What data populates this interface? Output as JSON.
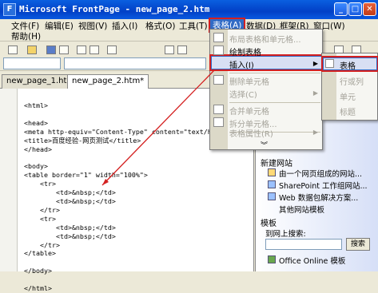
{
  "window": {
    "title": "Microsoft FrontPage - new_page_2.htm"
  },
  "menubar": {
    "items": [
      "文件(F)",
      "编辑(E)",
      "视图(V)",
      "插入(I)",
      "格式(O)",
      "工具(T)",
      "表格(A)",
      "数据(D)",
      "框架(R)",
      "窗口(W)"
    ],
    "help": "帮助(H)"
  },
  "tabs": [
    "new_page_1.htm*",
    "new_page_2.htm*"
  ],
  "code_lines": [
    "<html>",
    "",
    "<head>",
    "<meta http-equiv=\"Content-Type\" content=\"text/html; ch",
    "<title>百度经验-网页测试</title>",
    "</head>",
    "",
    "<body>",
    "<table border=\"1\" width=\"100%\">",
    "    <tr>",
    "        <td>&nbsp;</td>",
    "        <td>&nbsp;</td>",
    "    </tr>",
    "    <tr>",
    "        <td>&nbsp;</td>",
    "        <td>&nbsp;</td>",
    "    </tr>",
    "</table>",
    "",
    "</body>",
    "",
    "</html>"
  ],
  "table_menu": {
    "items": [
      {
        "label": "布局表格和单元格...",
        "disabled": true
      },
      {
        "label": "绘制表格",
        "disabled": false
      },
      {
        "label": "插入(I)",
        "disabled": false,
        "submenu": true
      },
      {
        "label": "删除单元格",
        "disabled": true
      },
      {
        "label": "选择(C)",
        "disabled": true,
        "submenu": true
      },
      {
        "label": "合并单元格",
        "disabled": true
      },
      {
        "label": "拆分单元格...",
        "disabled": true
      },
      {
        "label": "表格属性(R)",
        "disabled": true,
        "submenu": true
      }
    ]
  },
  "insert_submenu": {
    "items": [
      "表格",
      "行或列",
      "单元",
      "标题"
    ]
  },
  "taskpane": {
    "partial_label": "模板",
    "new_site_header": "新建网站",
    "new_site_links": [
      "由一个网页组成的网站...",
      "SharePoint 工作组网站...",
      "Web 数据包解决方案...",
      "其他网站模板"
    ],
    "templates_header": "模板",
    "search_label": "到网上搜索:",
    "go_button": "搜索",
    "office_online": "Office Online 模板"
  },
  "colors": {
    "title_bar": "#0a5fe0",
    "highlight": "#316ac5",
    "annotation_red": "#d42020"
  }
}
